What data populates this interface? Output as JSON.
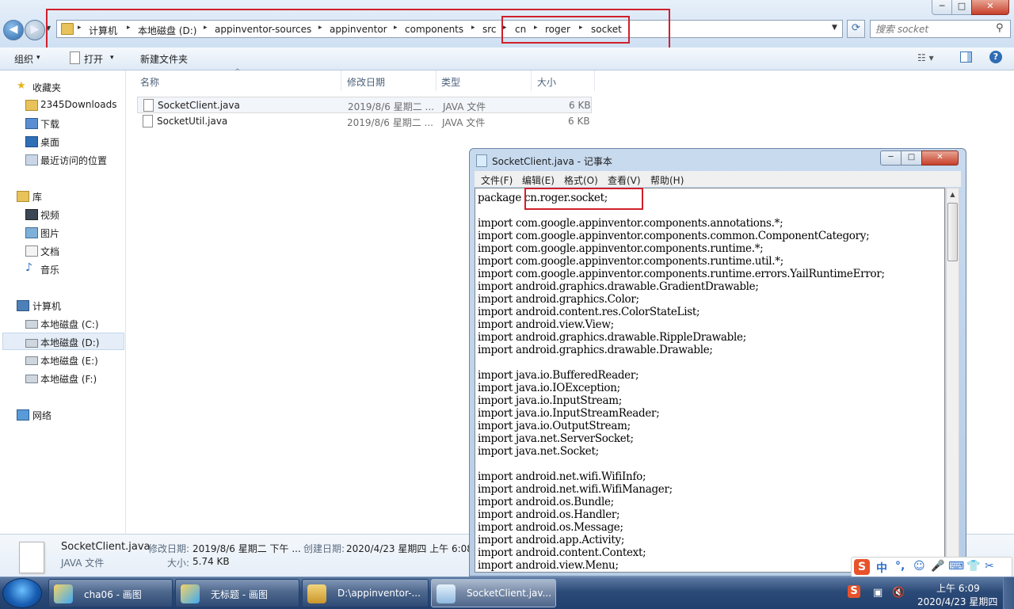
{
  "window": {
    "min_glyph": "─",
    "max_glyph": "□",
    "close_glyph": "✕"
  },
  "address_bar": {
    "crumbs": [
      "计算机",
      "本地磁盘 (D:)",
      "appinventor-sources",
      "appinventor",
      "components",
      "src",
      "cn",
      "roger",
      "socket"
    ],
    "separator_glyph": "▸"
  },
  "search": {
    "placeholder": "搜索 socket",
    "icon": "search-icon",
    "glyph": "⚲"
  },
  "toolbar": {
    "organize": "组织",
    "open": "打开",
    "new_folder": "新建文件夹",
    "dropdown_glyph": "▾",
    "help_glyph": "?"
  },
  "nav": {
    "favorites": "收藏夹",
    "favorites_items": [
      "2345Downloads",
      "下载",
      "桌面",
      "最近访问的位置"
    ],
    "libraries": "库",
    "libraries_items": [
      "视频",
      "图片",
      "文档",
      "音乐"
    ],
    "computer": "计算机",
    "computer_items": [
      "本地磁盘 (C:)",
      "本地磁盘 (D:)",
      "本地磁盘 (E:)",
      "本地磁盘 (F:)"
    ],
    "network": "网络"
  },
  "file_list": {
    "columns": [
      "名称",
      "修改日期",
      "类型",
      "大小"
    ],
    "rows": [
      {
        "name": "SocketClient.java",
        "date": "2019/8/6 星期二 ...",
        "type": "JAVA 文件",
        "size": "6 KB"
      },
      {
        "name": "SocketUtil.java",
        "date": "2019/8/6 星期二 ...",
        "type": "JAVA 文件",
        "size": "6 KB"
      }
    ]
  },
  "details": {
    "filename": "SocketClient.java",
    "filetype": "JAVA 文件",
    "modified_label": "修改日期:",
    "modified_value": "2019/8/6 星期二 下午 ...",
    "created_label": "创建日期:",
    "created_value": "2020/4/23 星期四 上午 6:08",
    "size_label": "大小:",
    "size_value": "5.74 KB"
  },
  "notepad": {
    "title": "SocketClient.java - 记事本",
    "menus": [
      "文件(F)",
      "编辑(E)",
      "格式(O)",
      "查看(V)",
      "帮助(H)"
    ],
    "lines": [
      "package cn.roger.socket;",
      "",
      "import com.google.appinventor.components.annotations.*;",
      "import com.google.appinventor.components.common.ComponentCategory;",
      "import com.google.appinventor.components.runtime.*;",
      "import com.google.appinventor.components.runtime.util.*;",
      "import com.google.appinventor.components.runtime.errors.YailRuntimeError;",
      "import android.graphics.drawable.GradientDrawable;",
      "import android.graphics.Color;",
      "import android.content.res.ColorStateList;",
      "import android.view.View;",
      "import android.graphics.drawable.RippleDrawable;",
      "import android.graphics.drawable.Drawable;",
      "",
      "import java.io.BufferedReader;",
      "import java.io.IOException;",
      "import java.io.InputStream;",
      "import java.io.InputStreamReader;",
      "import java.io.OutputStream;",
      "import java.net.ServerSocket;",
      "import java.net.Socket;",
      "",
      "import android.net.wifi.WifiInfo;",
      "import android.net.wifi.WifiManager;",
      "import android.os.Bundle;",
      "import android.os.Handler;",
      "import android.os.Message;",
      "import android.app.Activity;",
      "import android.content.Context;",
      "import android.view.Menu;"
    ]
  },
  "ime": {
    "logo": "S",
    "items": [
      "中",
      "°,",
      "☺",
      "🎤",
      "⌨",
      "👕",
      "✂"
    ]
  },
  "taskbar": {
    "tasks": [
      "cha06 - 画图",
      "无标题 - 画图",
      "D:\\appinventor-...",
      "SocketClient.jav..."
    ],
    "time": "上午 6:09",
    "date": "2020/4/23 星期四"
  },
  "colors": {
    "highlight": "#d0202a",
    "accent": "#2e6db4"
  }
}
